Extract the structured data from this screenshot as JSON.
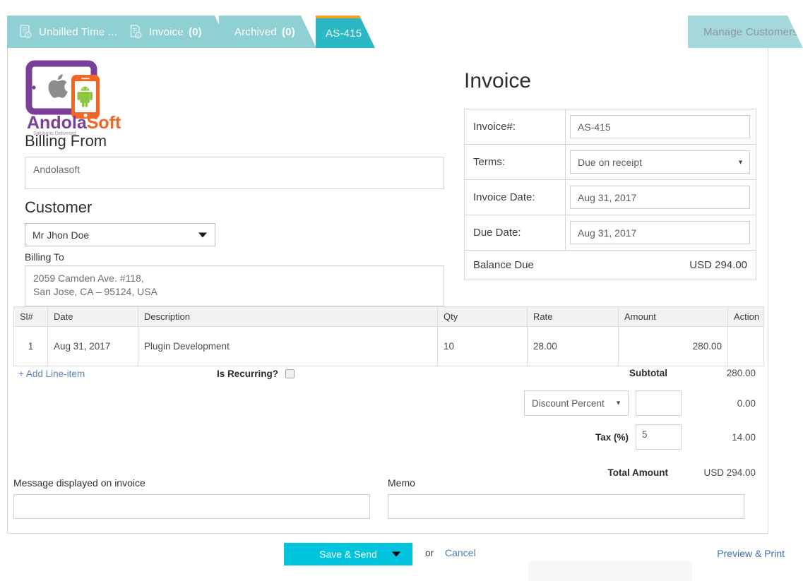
{
  "tabs": [
    {
      "label": "Unbilled Time ...",
      "count": "",
      "icon": "invoice-dollar-icon",
      "active": false
    },
    {
      "label": "Invoice",
      "count": "(0)",
      "icon": "invoice-dollar-icon",
      "active": false
    },
    {
      "label": "Archived",
      "count": "(0)",
      "icon": "",
      "active": false
    },
    {
      "label": "AS-415",
      "count": "",
      "icon": "",
      "active": true
    }
  ],
  "manage_customers_tab": {
    "label": "Manage Customers"
  },
  "logo": {
    "name_part1": "Andola",
    "name_part2": "Soft",
    "tagline": "Solutions Delivered",
    "purple": "#7b3f98",
    "orange": "#f26522",
    "green": "#8cc63f",
    "gray": "#8c8c8c"
  },
  "billing_from": {
    "heading": "Billing From",
    "value": "Andolasoft"
  },
  "customer": {
    "heading": "Customer",
    "selected": "Mr Jhon Doe",
    "billing_to_label": "Billing To",
    "address_line1": "2059 Camden Ave. #118,",
    "address_line2": "San Jose, CA – 95124, USA"
  },
  "invoice": {
    "heading": "Invoice",
    "rows": [
      {
        "label": "Invoice#:",
        "value": "AS-415",
        "type": "text"
      },
      {
        "label": "Terms:",
        "value": "Due on receipt",
        "type": "select"
      },
      {
        "label": "Invoice Date:",
        "value": "Aug 31, 2017",
        "type": "text"
      },
      {
        "label": "Due Date:",
        "value": "Aug 31, 2017",
        "type": "text"
      }
    ],
    "balance_due_label": "Balance Due",
    "balance_due_value": "USD 294.00"
  },
  "line_items": {
    "columns": [
      "Sl#",
      "Date",
      "Description",
      "Qty",
      "Rate",
      "Amount",
      "Action"
    ],
    "rows": [
      {
        "sl": "1",
        "date": "Aug 31, 2017",
        "description": "Plugin Development",
        "qty": "10",
        "rate": "28.00",
        "amount": "280.00",
        "action": ""
      }
    ]
  },
  "actions": {
    "add_line_item": "+ Add Line-item",
    "is_recurring_label": "Is Recurring?",
    "is_recurring_checked": false
  },
  "totals": {
    "subtotal_label": "Subtotal",
    "subtotal_value": "280.00",
    "discount_type": "Discount Percent",
    "discount_input": "",
    "discount_value": "0.00",
    "tax_label": "Tax (%)",
    "tax_input": "5",
    "tax_value": "14.00",
    "total_label": "Total Amount",
    "total_value": "USD 294.00"
  },
  "notes": {
    "message_label": "Message displayed on invoice",
    "message_value": "",
    "memo_label": "Memo",
    "memo_value": ""
  },
  "footer": {
    "save_label": "Save & Send",
    "or_label": "or",
    "cancel_label": "Cancel",
    "preview_label": "Preview & Print"
  },
  "colors": {
    "tab_inactive": "#8fd0d2",
    "tab_active": "#2bb8c4",
    "tab_active_top": "#f0a22a",
    "manage_tab": "#a4d8da",
    "primary_button": "#00c3dd",
    "link": "#4a7cb5"
  }
}
